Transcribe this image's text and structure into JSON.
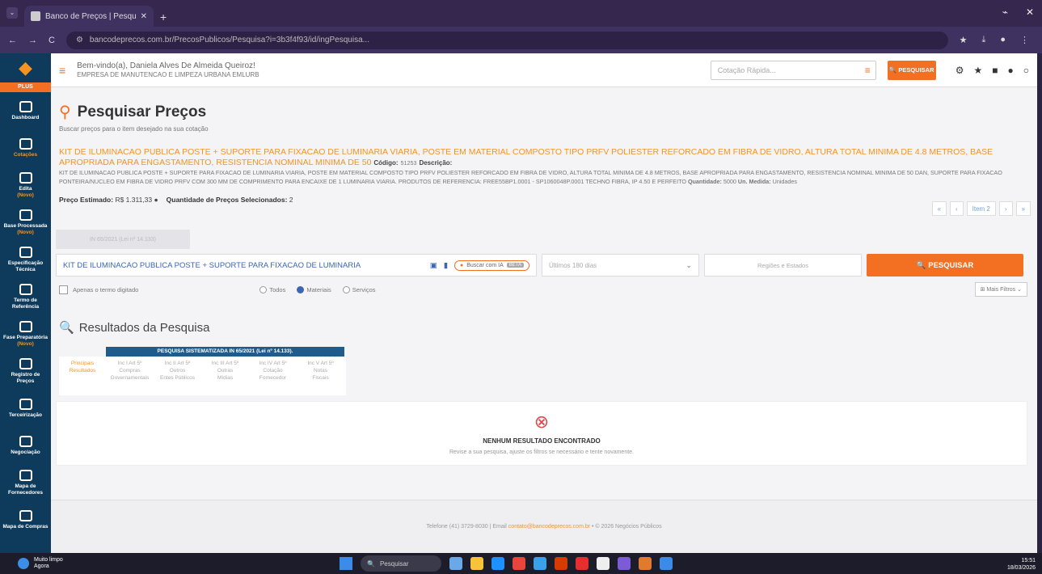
{
  "browser": {
    "tab_title": "Banco de Preços | Pesquisa",
    "new_tab": "+",
    "url": "bancodeprecos.com.br/PrecosPublicos/Pesquisa?i=3b3f4f93/id/ingPesquisa..."
  },
  "header": {
    "welcome": "Bem-vindo(a), Daniela Alves De Almeida Queiroz!",
    "company": "EMPRESA DE MANUTENCAO E LIMPEZA URBANA EMLURB",
    "quick_search_placeholder": "Cotação Rápida...",
    "quick_search_button": "PESQUISAR"
  },
  "sidebar": {
    "plus": "PLUS",
    "items": [
      {
        "label": "Dashboard",
        "sub": ""
      },
      {
        "label": "",
        "sub": "Cotações"
      },
      {
        "label": "Edita",
        "sub": "(Novo)"
      },
      {
        "label": "Base Processada",
        "sub": "(Novo)"
      },
      {
        "label": "Especificação Técnica",
        "sub": ""
      },
      {
        "label": "Termo de Referência",
        "sub": ""
      },
      {
        "label": "Fase Preparatória",
        "sub": "(Novo)"
      },
      {
        "label": "Registro de Preços",
        "sub": ""
      },
      {
        "label": "Terceirização",
        "sub": ""
      },
      {
        "label": "Negociação",
        "sub": ""
      },
      {
        "label": "Mapa de Fornecedores",
        "sub": ""
      },
      {
        "label": "Mapa de Compras",
        "sub": ""
      }
    ]
  },
  "page": {
    "title": "Pesquisar Preços",
    "subtitle": "Buscar preços para o item desejado na sua cotação",
    "item_title": "KIT DE ILUMINACAO PUBLICA POSTE + SUPORTE PARA FIXACAO DE LUMINARIA VIARIA, POSTE EM MATERIAL COMPOSTO TIPO PRFV POLIESTER REFORCADO EM FIBRA DE VIDRO, ALTURA TOTAL MINIMA DE 4.8 METROS, BASE APROPRIADA PARA ENGASTAMENTO, RESISTENCIA NOMINAL MINIMA DE 50",
    "code_label": "Código:",
    "code_value": "51253",
    "desc_label": "Descrição:",
    "desc_value": "KIT DE ILUMINACAO PUBLICA POSTE + SUPORTE PARA FIXACAO DE LUMINARIA VIARIA, POSTE EM MATERIAL COMPOSTO TIPO PRFV POLIESTER REFORCADO EM FIBRA DE VIDRO, ALTURA TOTAL MINIMA DE 4.8 METROS, BASE APROPRIADA PARA ENGASTAMENTO, RESISTENCIA NOMINAL MINIMA DE 50 DAN, SUPORTE PARA FIXACAO PONTEIRA/NUCLEO EM FIBRA DE VIDRO PRFV COM 300 MM DE COMPRIMENTO PARA ENCAIXE DE 1 LUMINARIA VIARIA. PRODUTOS DE REFERENCIA: FREE55BP1.0001 - SP1060048P.0001 TECHNO FIBRA, IP 4.50 E PERFEITO",
    "qty_label": "Quantidade:",
    "qty_value": "5000",
    "unit_label": "Un. Medida:",
    "unit_value": "Unidades",
    "est_label": "Preço Estimado:",
    "est_value": "R$ 1.311,33",
    "sel_label": "Quantidade de Preços Selecionados:",
    "sel_value": "2",
    "pager": {
      "first": "«",
      "prev": "‹",
      "current": "Item 2",
      "next": "›",
      "last": "»"
    },
    "disabled_button": "IN 65/2021 (Lei nº 14.133)",
    "search_value": "KIT DE ILUMINACAO PUBLICA POSTE + SUPORTE PARA FIXACAO DE LUMINARIA",
    "ia_label": "Buscar com IA",
    "ia_badge": "BETA",
    "period_select": "Últimos 180 dias",
    "region_select": "Regiões e Estados",
    "search_button": "PESQUISAR",
    "exact_term": "Apenas o termo digitado",
    "radio_all": "Todos",
    "radio_materials": "Materiais",
    "radio_services": "Serviços",
    "more_filters": "Mais Filtros",
    "results_title": "Resultados da Pesquisa",
    "table_header": "PESQUISA SISTEMATIZADA IN 65/2021 (Lei nº 14.133).",
    "table_cols": [
      {
        "l1": "Principais",
        "l2": "Resultados",
        "l3": ""
      },
      {
        "l1": "Inc I Art 5º",
        "l2": "Compras",
        "l3": "Governamentais"
      },
      {
        "l1": "Inc II Art 5º",
        "l2": "Outros",
        "l3": "Entes Públicos"
      },
      {
        "l1": "Inc III Art 5º",
        "l2": "Outras",
        "l3": "Mídias"
      },
      {
        "l1": "Inc IV Art 5º",
        "l2": "Cotação",
        "l3": "Fornecedor"
      },
      {
        "l1": "Inc V Art 5º",
        "l2": "Notas",
        "l3": "Fiscais"
      }
    ],
    "empty_title": "NENHUM RESULTADO ENCONTRADO",
    "empty_sub": "Revise a sua pesquisa, ajuste os filtros se necessário e tente novamente.",
    "footer_text": "Telefone (41) 3729-8030 | Email",
    "footer_email": "contato@bancodeprecos.com.br",
    "footer_copy": "• © 2026 Negócios Públicos"
  },
  "taskbar": {
    "weather_l1": "Muito limpo",
    "weather_l2": "Agora",
    "search": "Pesquisar",
    "time": "15:51",
    "date": "18/03/2026"
  }
}
